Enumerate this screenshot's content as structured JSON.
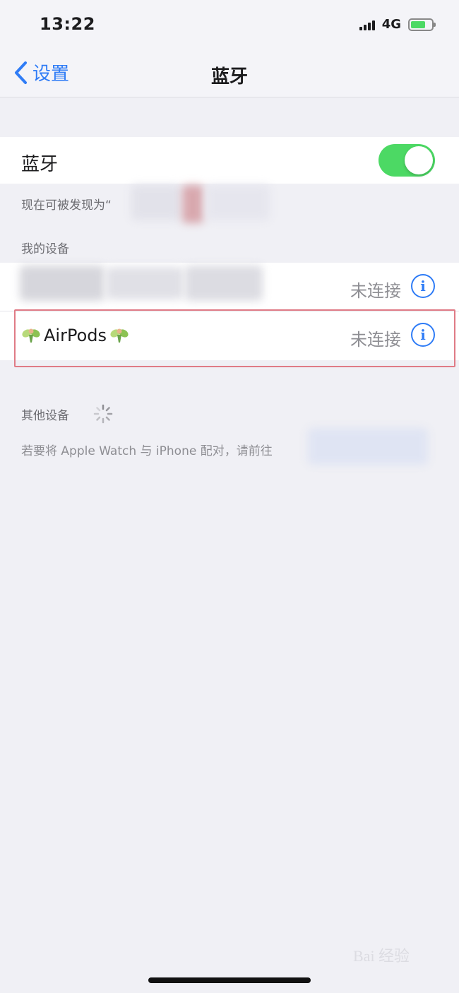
{
  "status_bar": {
    "time": "13:22",
    "network": "4G"
  },
  "nav": {
    "back_label": "设置",
    "title": "蓝牙"
  },
  "bluetooth": {
    "label": "蓝牙",
    "enabled": true,
    "discoverable_text": "现在可被发现为“"
  },
  "my_devices": {
    "header": "我的设备",
    "items": [
      {
        "name": "",
        "status": "未连接",
        "info": "i"
      },
      {
        "name": "AirPods",
        "status": "未连接",
        "info": "i"
      }
    ]
  },
  "other_devices": {
    "header": "其他设备",
    "pair_hint": "若要将 Apple Watch 与 iPhone 配对，请前往"
  },
  "watermark": "Bai 经验",
  "colors": {
    "accent": "#2f7cf6",
    "toggle_on": "#4cd964",
    "highlight": "#e07b86"
  }
}
